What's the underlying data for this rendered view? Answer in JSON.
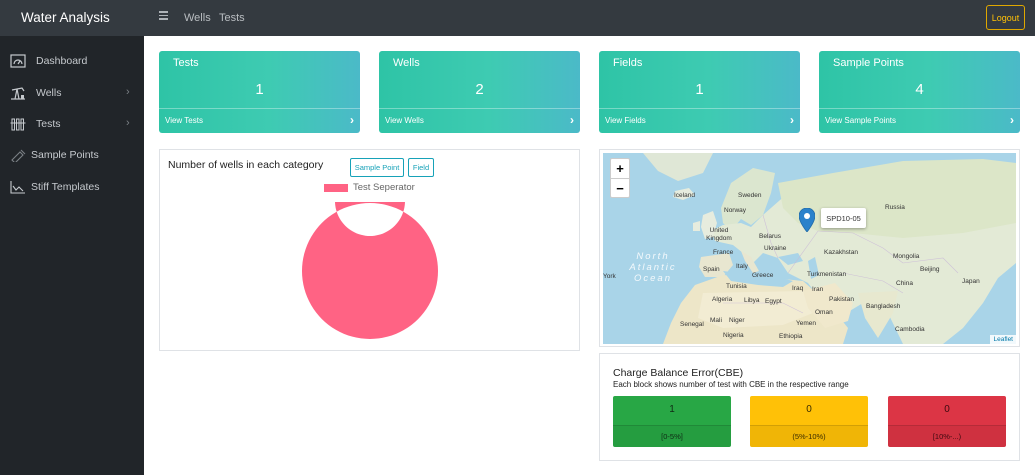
{
  "app": {
    "title": "Water Analysis"
  },
  "topnav": {
    "links": [
      "Wells",
      "Tests"
    ],
    "logout": "Logout"
  },
  "sidebar": {
    "items": [
      {
        "label": "Dashboard",
        "icon": "dashboard-icon",
        "has_children": false
      },
      {
        "label": "Wells",
        "icon": "oil-pump-icon",
        "has_children": true
      },
      {
        "label": "Tests",
        "icon": "test-tubes-icon",
        "has_children": true
      },
      {
        "label": "Sample Points",
        "icon": "sample-point-icon",
        "has_children": false
      },
      {
        "label": "Stiff Templates",
        "icon": "line-chart-icon",
        "has_children": false
      }
    ]
  },
  "cards": [
    {
      "title": "Tests",
      "count": "1",
      "link": "View Tests"
    },
    {
      "title": "Wells",
      "count": "2",
      "link": "View Wells"
    },
    {
      "title": "Fields",
      "count": "1",
      "link": "View Fields"
    },
    {
      "title": "Sample Points",
      "count": "4",
      "link": "View Sample Points"
    }
  ],
  "wells_chart": {
    "title": "Number of wells in each category",
    "buttons": [
      "Sample Point",
      "Field"
    ],
    "legend": "Test Seperator"
  },
  "chart_data": {
    "type": "pie",
    "variant": "doughnut",
    "labels": [
      "Test Seperator"
    ],
    "values": [
      2
    ],
    "colors": [
      "#ff6384"
    ],
    "legend_position": "top"
  },
  "map": {
    "zoom_in": "+",
    "zoom_out": "−",
    "marker_label": "SPD10-05",
    "attribution": "Leaflet",
    "place_labels": [
      "Iceland",
      "Sweden",
      "Norway",
      "Russia",
      "United Kingdom",
      "Belarus",
      "Ukraine",
      "France",
      "Kazakhstan",
      "Mongolia",
      "Spain",
      "Italy",
      "Greece",
      "Turkmenistan",
      "Beijing",
      "Tunisia",
      "Iraq",
      "Iran",
      "China",
      "Japan",
      "Algeria",
      "Libya",
      "Egypt",
      "Pakistan",
      "Bangladesh",
      "Oman",
      "Senegal",
      "Mali",
      "Niger",
      "Yemen",
      "Nigeria",
      "Ethiopia",
      "Cambodia",
      "York"
    ],
    "ocean_label": "North Atlantic Ocean"
  },
  "cbe": {
    "title": "Charge Balance Error(CBE)",
    "subtitle": "Each block shows number of test with CBE in the respective range",
    "blocks": [
      {
        "value": "1",
        "range": "[0-5%]",
        "color": "#28a745"
      },
      {
        "value": "0",
        "range": "(5%-10%)",
        "color": "#ffc107"
      },
      {
        "value": "0",
        "range": "[10%-...)",
        "color": "#dc3545"
      }
    ]
  }
}
